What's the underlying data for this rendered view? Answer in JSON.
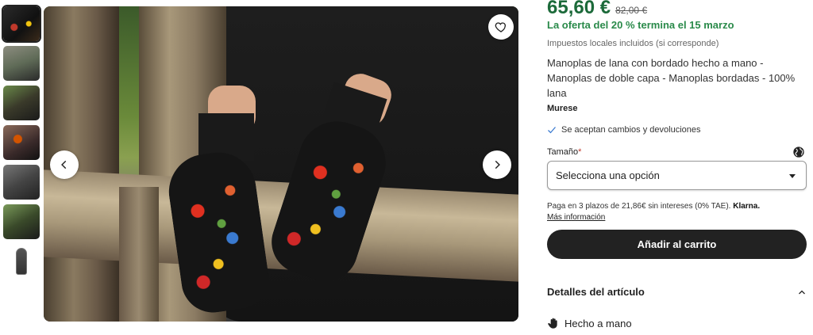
{
  "thumbnails": [
    "thumb-1",
    "thumb-2",
    "thumb-3",
    "thumb-4",
    "thumb-5",
    "thumb-6",
    "thumb-7"
  ],
  "gallery": {
    "favorite_icon": "heart-icon",
    "prev_icon": "chevron-left-icon",
    "next_icon": "chevron-right-icon"
  },
  "product": {
    "price": "65,60 €",
    "old_price": "82,00 €",
    "offer": "La oferta del 20 % termina el 15 marzo",
    "taxes": "Impuestos locales incluidos (si corresponde)",
    "title": "Manoplas de lana con bordado hecho a mano - Manoplas de doble capa - Manoplas bordadas - 100% lana",
    "shop": "Murese",
    "returns": "Se aceptan cambios y devoluciones"
  },
  "size": {
    "label": "Tamaño",
    "required_mark": "*",
    "placeholder": "Selecciona una opción"
  },
  "klarna": {
    "text": "Paga en 3 plazos de 21,86€ sin intereses (0% TAE).",
    "brand": "Klarna.",
    "more": "Más información"
  },
  "cart": {
    "label": "Añadir al carrito"
  },
  "details": {
    "title": "Detalles del artículo",
    "handmade": "Hecho a mano"
  },
  "colors": {
    "price": "#1c6a3a",
    "offer": "#2a8a4a",
    "button": "#222222"
  }
}
